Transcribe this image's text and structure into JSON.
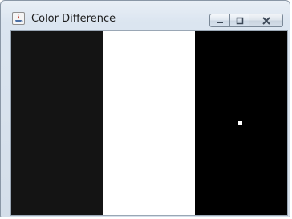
{
  "window": {
    "title": "Color Difference",
    "controls": {
      "minimize": "minimize",
      "maximize": "maximize",
      "close": "close"
    }
  },
  "canvas": {
    "stripes": [
      {
        "color": "#141414"
      },
      {
        "color": "#ffffff"
      },
      {
        "color": "#000000"
      }
    ],
    "dot_color": "#ffffff"
  }
}
